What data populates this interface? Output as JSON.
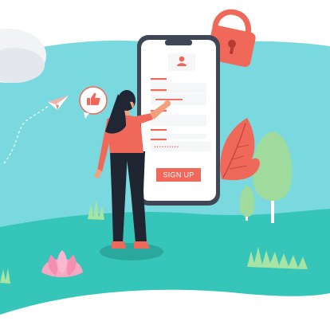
{
  "colors": {
    "sky_teal": "#7ad9df",
    "ground_teal": "#35c5b9",
    "accent_coral": "#f0685a",
    "phone_frame": "#3f4656",
    "screen_bg": "#ffffff",
    "hair": "#202634",
    "pants": "#1f2531",
    "shirt": "#f0685a",
    "skin": "#f4a07d",
    "lotus": "#f7a7c1",
    "tree_green": "#9edb9d",
    "grass": "#a7e3a3"
  },
  "form": {
    "password_mask": "••••••••••",
    "submit_label": "SIGN UP"
  },
  "icons": {
    "lock": "padlock-icon",
    "like": "thumbs-up-icon",
    "plane": "paper-plane-icon",
    "avatar": "user-avatar-icon"
  }
}
